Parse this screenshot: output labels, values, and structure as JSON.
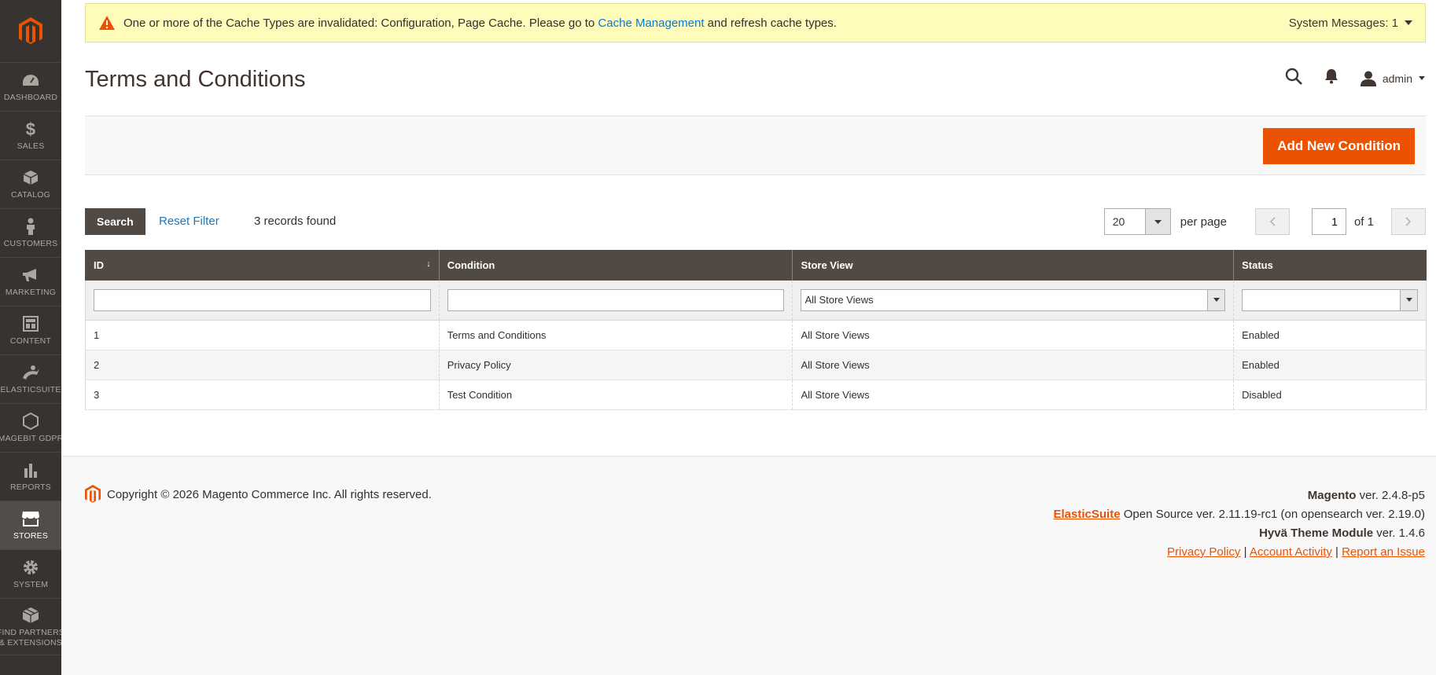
{
  "sidebar": {
    "items": [
      {
        "label": "DASHBOARD",
        "icon": "dashboard-icon"
      },
      {
        "label": "SALES",
        "icon": "dollar-icon"
      },
      {
        "label": "CATALOG",
        "icon": "box-icon"
      },
      {
        "label": "CUSTOMERS",
        "icon": "person-icon"
      },
      {
        "label": "MARKETING",
        "icon": "megaphone-icon"
      },
      {
        "label": "CONTENT",
        "icon": "layout-icon"
      },
      {
        "label": "ELASTICSUITE",
        "icon": "elasticsuite-icon"
      },
      {
        "label": "MAGEBIT GDPR",
        "icon": "hexagon-icon"
      },
      {
        "label": "REPORTS",
        "icon": "bar-chart-icon"
      },
      {
        "label": "STORES",
        "icon": "store-icon"
      },
      {
        "label": "SYSTEM",
        "icon": "gear-icon"
      },
      {
        "label": "FIND PARTNERS",
        "label2": "& EXTENSIONS",
        "icon": "cube-icon"
      }
    ]
  },
  "system_message": {
    "text_before": "One or more of the Cache Types are invalidated: Configuration, Page Cache. Please go to ",
    "link": "Cache Management",
    "text_after": " and refresh cache types.",
    "counter": "System Messages: 1"
  },
  "header": {
    "title": "Terms and Conditions",
    "user": "admin"
  },
  "actions": {
    "add_label": "Add New Condition"
  },
  "toolbar": {
    "search_label": "Search",
    "reset_label": "Reset Filter",
    "records": "3 records found",
    "per_page_value": "20",
    "per_page_label": "per page",
    "page_value": "1",
    "page_of": "of 1"
  },
  "grid": {
    "columns": [
      "ID",
      "Condition",
      "Store View",
      "Status"
    ],
    "filter_store_view": "All Store Views",
    "rows": [
      [
        "1",
        "Terms and Conditions",
        "All Store Views",
        "Enabled"
      ],
      [
        "2",
        "Privacy Policy",
        "All Store Views",
        "Enabled"
      ],
      [
        "3",
        "Test Condition",
        "All Store Views",
        "Disabled"
      ]
    ]
  },
  "footer": {
    "copyright": "Copyright © 2026 Magento Commerce Inc. All rights reserved.",
    "magento_name": "Magento",
    "magento_ver": " ver. 2.4.8-p5",
    "elasticsuite_name": "ElasticSuite",
    "elasticsuite_ver": " Open Source ver. 2.11.19-rc1 (on opensearch ver. 2.19.0)",
    "hyva_name": "Hyvä Theme Module",
    "hyva_ver": " ver. 1.4.6",
    "privacy": "Privacy Policy",
    "sep1": " | ",
    "activity": " Account Activity",
    "sep2": " | ",
    "report": "Report an Issue"
  },
  "colors": {
    "accent": "#eb5202",
    "sidebar": "#373330",
    "header": "#514943",
    "link": "#1979c3"
  }
}
